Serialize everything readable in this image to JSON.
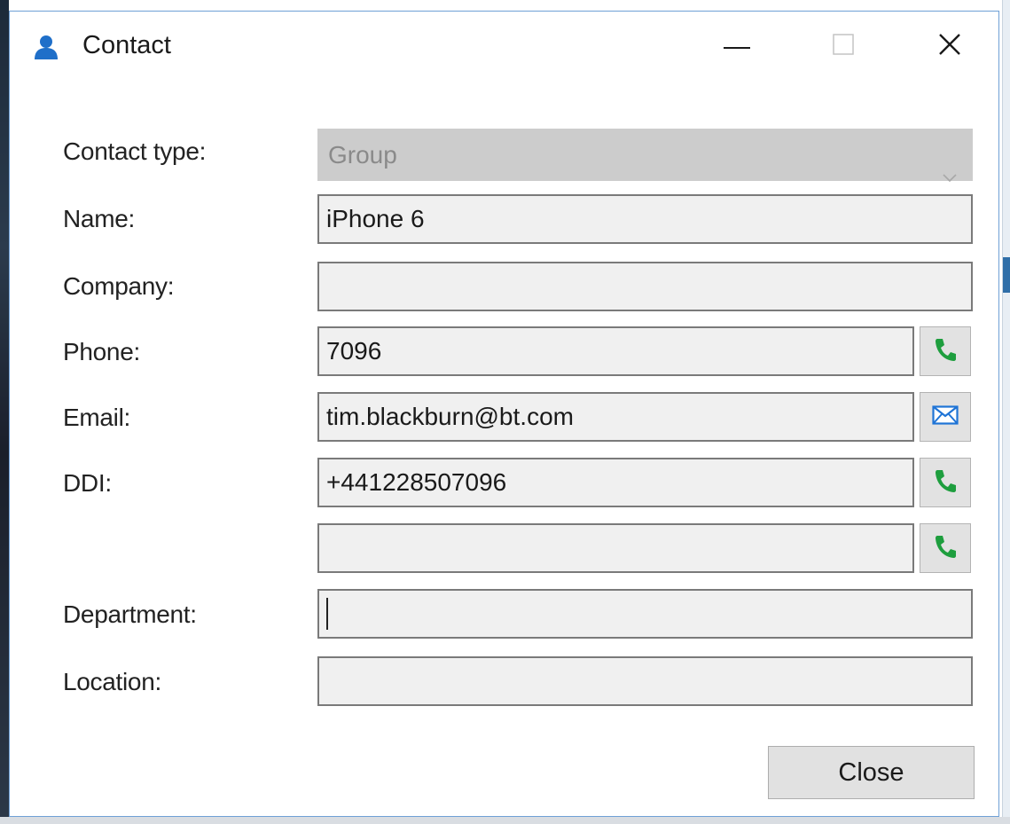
{
  "window": {
    "title": "Contact",
    "icon": "contact-person-icon",
    "controls": [
      "minimize-icon",
      "maximize-icon",
      "close-icon"
    ]
  },
  "form": {
    "contact_type": {
      "label": "Contact type:",
      "value": "Group",
      "disabled": true
    },
    "name": {
      "label": "Name:",
      "value": "iPhone 6"
    },
    "company": {
      "label": "Company:",
      "value": ""
    },
    "phone": {
      "label": "Phone:",
      "value": "7096",
      "action_icon": "phone-icon"
    },
    "email": {
      "label": "Email:",
      "value": "tim.blackburn@bt.com",
      "action_icon": "envelope-icon"
    },
    "ddi": {
      "label": "DDI:",
      "value": "+441228507096",
      "action_icon": "phone-icon"
    },
    "extra_phone": {
      "label": "",
      "value": "",
      "action_icon": "phone-icon"
    },
    "department": {
      "label": "Department:",
      "value": ""
    },
    "location": {
      "label": "Location:",
      "value": ""
    }
  },
  "buttons": {
    "close_label": "Close"
  },
  "colors": {
    "phone_icon": "#1e9e3e",
    "mail_icon": "#1f74d6",
    "title_icon": "#1f6fc9",
    "dialog_border": "#6fa0d6"
  }
}
